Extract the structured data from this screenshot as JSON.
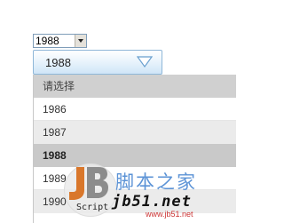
{
  "native_select": {
    "value": "1988"
  },
  "custom_select": {
    "value": "1988",
    "accent_color": "#8fb7d8"
  },
  "dropdown": {
    "options": [
      {
        "label": "请选择",
        "state": "header"
      },
      {
        "label": "1986",
        "state": "plain"
      },
      {
        "label": "1987",
        "state": "alt"
      },
      {
        "label": "1988",
        "state": "selected"
      },
      {
        "label": "1989",
        "state": "plain"
      },
      {
        "label": "1990",
        "state": "alt"
      }
    ]
  },
  "watermark": {
    "logo_letters": "JB",
    "script_label": "Script",
    "brand_cn": "脚本之家",
    "domain": "jb51.net",
    "url": "www.jb51.net",
    "brand_color": "#5c93d6"
  }
}
